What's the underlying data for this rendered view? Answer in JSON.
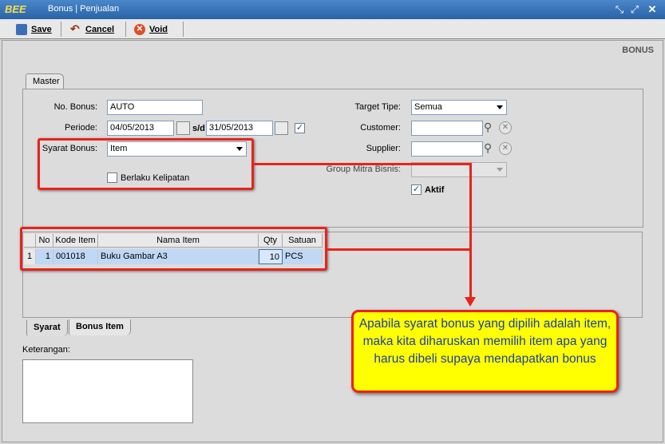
{
  "window": {
    "logo_text": "BEE",
    "title": "Bonus | Penjualan"
  },
  "toolbar": {
    "save_label": "Save",
    "cancel_label": "Cancel",
    "void_label": "Void"
  },
  "heading": "BONUS",
  "tabs": {
    "master": "Master",
    "syarat": "Syarat",
    "bonus_item": "Bonus Item"
  },
  "form": {
    "no_bonus_label": "No. Bonus:",
    "no_bonus_value": "AUTO",
    "periode_label": "Periode:",
    "periode_from": "04/05/2013",
    "periode_sep": "s/d",
    "periode_to": "31/05/2013",
    "syarat_bonus_label": "Syarat Bonus:",
    "syarat_bonus_value": "Item",
    "berlaku_kelipatan_label": "Berlaku Kelipatan",
    "target_tipe_label": "Target Tipe:",
    "target_tipe_value": "Semua",
    "customer_label": "Customer:",
    "supplier_label": "Supplier:",
    "group_mitra_label": "Group Mitra Bisnis:",
    "aktif_label": "Aktif"
  },
  "grid": {
    "columns": [
      "No",
      "Kode Item",
      "Nama Item",
      "Qty",
      "Satuan"
    ],
    "rows": [
      {
        "rownum": "1",
        "no": "1",
        "kode": "001018",
        "nama": "Buku Gambar A3",
        "qty": "10",
        "satuan": "PCS"
      }
    ]
  },
  "keterangan_label": "Keterangan:",
  "callout": "Apabila syarat bonus yang dipilih adalah item, maka kita diharuskan memilih item apa yang harus dibeli supaya mendapatkan bonus",
  "colors": {
    "titlebar": "#2a62a8",
    "annotation_red": "#e8231c",
    "callout_bg": "#ffff00",
    "callout_text": "#1c3fa8",
    "row_selected": "#bfd8f5"
  }
}
